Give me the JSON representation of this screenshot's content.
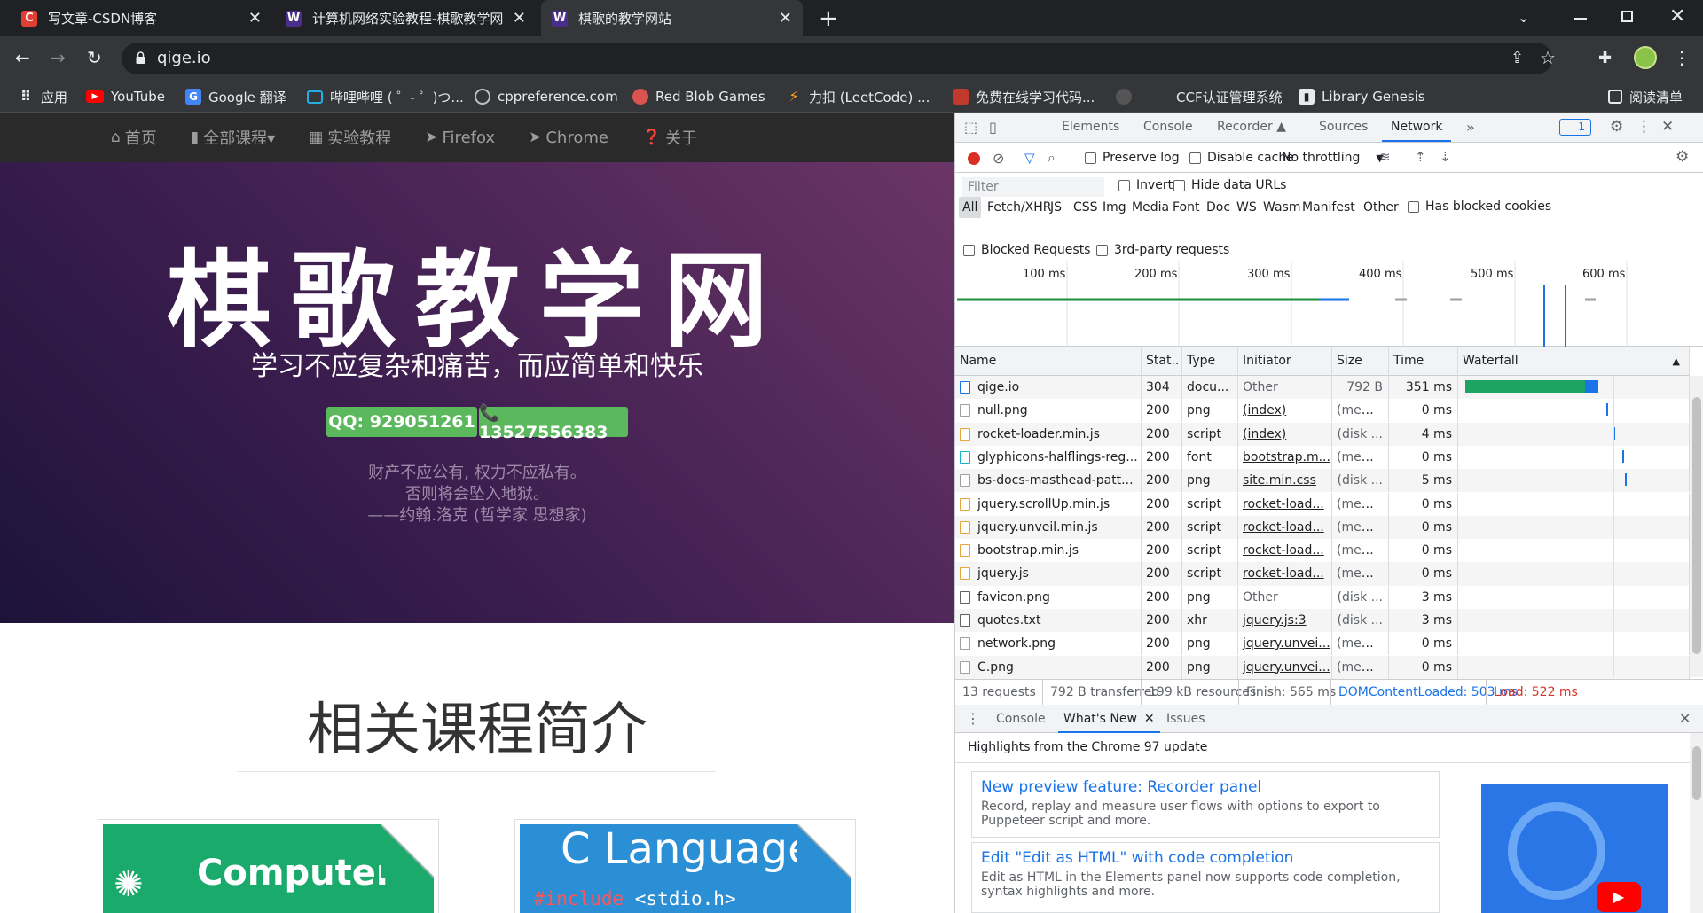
{
  "browser": {
    "tabs": [
      {
        "label": "写文章-CSDN博客",
        "favicon": "C",
        "color": "#e33e33"
      },
      {
        "label": "计算机网络实验教程-棋歌教学网",
        "favicon": "W",
        "color": "#4a2e8c"
      },
      {
        "label": "棋歌的教学网站",
        "favicon": "W",
        "color": "#4a2e8c"
      }
    ],
    "new_tab": "+",
    "url": "qige.io",
    "bookmarks": [
      {
        "label": "应用",
        "icon": "apps-grid-icon"
      },
      {
        "label": "YouTube",
        "icon": "youtube-icon"
      },
      {
        "label": "Google 翻译",
        "icon": "translate-icon"
      },
      {
        "label": "哔哩哔哩 ( ゜- ゜)つ...",
        "icon": "bilibili-icon"
      },
      {
        "label": "cppreference.com",
        "icon": "cppref-icon"
      },
      {
        "label": "Red Blob Games",
        "icon": "redblob-icon"
      },
      {
        "label": "力扣 (LeetCode) ...",
        "icon": "leetcode-icon"
      },
      {
        "label": "免费在线学习代码...",
        "icon": "code-icon"
      },
      {
        "label": "",
        "icon": "github-icon"
      },
      {
        "label": "CCF认证管理系统",
        "icon": "ccf-icon"
      },
      {
        "label": "Library Genesis",
        "icon": "book-icon"
      }
    ],
    "reading_list": "阅读清单"
  },
  "site": {
    "nav": [
      {
        "label": "首页",
        "icon": "home-icon"
      },
      {
        "label": "全部课程▾",
        "icon": "book-icon"
      },
      {
        "label": "实验教程",
        "icon": "grid-icon"
      },
      {
        "label": "Firefox",
        "icon": "send-icon"
      },
      {
        "label": "Chrome",
        "icon": "send-icon"
      },
      {
        "label": "关于",
        "icon": "question-icon"
      }
    ],
    "title": "棋歌教学网",
    "subtitle": "学习不应复杂和痛苦，而应简单和快乐",
    "qq": "QQ: 929051261",
    "phone": "📞 13527556383",
    "quote_lines": [
      "财产不应公有, 权力不应私有。",
      "否则将会坠入地狱。",
      "——约翰.洛克 (哲学家 思想家)"
    ],
    "section_title": "相关课程简介",
    "cards": [
      {
        "title": "Computer",
        "color": "#1aaa6b"
      },
      {
        "title": "C  Language",
        "code_include": "#include",
        "code_rest": " <stdio.h>",
        "color": "#2b8fd6"
      }
    ]
  },
  "devtools": {
    "tabs": [
      "Elements",
      "Console",
      "Recorder ▲",
      "Sources",
      "Network",
      "»"
    ],
    "active_tab": "Network",
    "issues_count": "1",
    "preserve_log": "Preserve log",
    "disable_cache": "Disable cache",
    "throttling": "No throttling",
    "filter_placeholder": "Filter",
    "invert": "Invert",
    "hide_data_urls": "Hide data URLs",
    "types": [
      "All",
      "Fetch/XHR",
      "JS",
      "CSS",
      "Img",
      "Media",
      "Font",
      "Doc",
      "WS",
      "Wasm",
      "Manifest",
      "Other"
    ],
    "has_blocked_cookies": "Has blocked cookies",
    "blocked_requests": "Blocked Requests",
    "third_party": "3rd-party requests",
    "timeline_ticks": [
      "100 ms",
      "200 ms",
      "300 ms",
      "400 ms",
      "500 ms",
      "600 ms"
    ],
    "columns": [
      "Name",
      "Stat..",
      "Type",
      "Initiator",
      "Size",
      "Time",
      "Waterfall"
    ],
    "requests": [
      {
        "name": "qige.io",
        "status": "304",
        "type": "docu...",
        "initiator": "Other",
        "size": "792 B",
        "time": "351 ms",
        "icon": "doc-icon",
        "init_link": false
      },
      {
        "name": "null.png",
        "status": "200",
        "type": "png",
        "initiator": "(index)",
        "size": "(mem...",
        "time": "0 ms",
        "icon": "img-icon",
        "init_link": true
      },
      {
        "name": "rocket-loader.min.js",
        "status": "200",
        "type": "script",
        "initiator": "(index)",
        "size": "(disk ...",
        "time": "4 ms",
        "icon": "script-icon",
        "init_link": true
      },
      {
        "name": "glyphicons-halflings-reg...",
        "status": "200",
        "type": "font",
        "initiator": "bootstrap.m...",
        "size": "(mem...",
        "time": "0 ms",
        "icon": "font-icon",
        "init_link": true
      },
      {
        "name": "bs-docs-masthead-patt...",
        "status": "200",
        "type": "png",
        "initiator": "site.min.css",
        "size": "(disk ...",
        "time": "5 ms",
        "icon": "img-icon",
        "init_link": true
      },
      {
        "name": "jquery.scrollUp.min.js",
        "status": "200",
        "type": "script",
        "initiator": "rocket-load...",
        "size": "(mem...",
        "time": "0 ms",
        "icon": "script-icon",
        "init_link": true
      },
      {
        "name": "jquery.unveil.min.js",
        "status": "200",
        "type": "script",
        "initiator": "rocket-load...",
        "size": "(mem...",
        "time": "0 ms",
        "icon": "script-icon",
        "init_link": true
      },
      {
        "name": "bootstrap.min.js",
        "status": "200",
        "type": "script",
        "initiator": "rocket-load...",
        "size": "(mem...",
        "time": "0 ms",
        "icon": "script-icon",
        "init_link": true
      },
      {
        "name": "jquery.js",
        "status": "200",
        "type": "script",
        "initiator": "rocket-load...",
        "size": "(mem...",
        "time": "0 ms",
        "icon": "script-icon",
        "init_link": true
      },
      {
        "name": "favicon.png",
        "status": "200",
        "type": "png",
        "initiator": "Other",
        "size": "(disk ...",
        "time": "3 ms",
        "icon": "file-icon",
        "init_link": false
      },
      {
        "name": "quotes.txt",
        "status": "200",
        "type": "xhr",
        "initiator": "jquery.js:3",
        "size": "(disk ...",
        "time": "3 ms",
        "icon": "file-icon",
        "init_link": true
      },
      {
        "name": "network.png",
        "status": "200",
        "type": "png",
        "initiator": "jquery.unvei...",
        "size": "(mem...",
        "time": "0 ms",
        "icon": "img-icon",
        "init_link": true
      },
      {
        "name": "C.png",
        "status": "200",
        "type": "png",
        "initiator": "jquery.unvei...",
        "size": "(mem...",
        "time": "0 ms",
        "icon": "img-icon",
        "init_link": true
      }
    ],
    "summary": {
      "requests": "13 requests",
      "transferred": "792 B transferred",
      "resources": "199 kB resources",
      "finish": "Finish: 565 ms",
      "dcl": "DOMContentLoaded: 503 ms",
      "load": "Load: 522 ms"
    },
    "drawer_tabs": [
      "Console",
      "What's New",
      "Issues"
    ],
    "drawer_header": "Highlights from the Chrome 97 update",
    "whats_new": [
      {
        "title": "New preview feature: Recorder panel",
        "body": "Record, replay and measure user flows with options to export to Puppeteer script and more."
      },
      {
        "title": "Edit \"Edit as HTML\" with code completion",
        "body": "Edit as HTML in the Elements panel now supports code completion, syntax highlights and more."
      }
    ]
  }
}
